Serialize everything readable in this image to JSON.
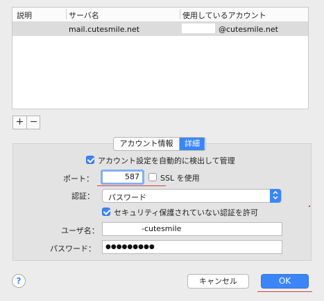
{
  "table": {
    "headers": [
      "説明",
      "サーバ名",
      "使用しているアカウント"
    ],
    "rows": [
      {
        "description": "",
        "server": "mail.cutesmile.net",
        "account": "@cutesmile.net"
      }
    ]
  },
  "controls": {
    "add_symbol": "+",
    "remove_symbol": "−"
  },
  "tabs": [
    {
      "label": "アカウント情報",
      "selected": false
    },
    {
      "label": "詳細",
      "selected": true
    }
  ],
  "form": {
    "auto_detect": {
      "label": "アカウント設定を自動的に検出して管理",
      "checked": true
    },
    "port": {
      "label": "ポート：",
      "value": "587"
    },
    "ssl": {
      "label": "SSL を使用",
      "checked": false
    },
    "auth": {
      "label": "認証：",
      "value": "パスワード"
    },
    "allow_insecure": {
      "label": "セキュリティ保護されていない認証を許可",
      "checked": true
    },
    "username": {
      "label": "ユーザ名：",
      "value": "-cutesmile"
    },
    "password": {
      "label": "パスワード：",
      "value": "●●●●●●●●●"
    }
  },
  "buttons": {
    "help": "?",
    "cancel": "キャンセル",
    "ok": "OK"
  },
  "colors": {
    "accent": "#3b86f7",
    "annotation_red": "#e0393a"
  }
}
